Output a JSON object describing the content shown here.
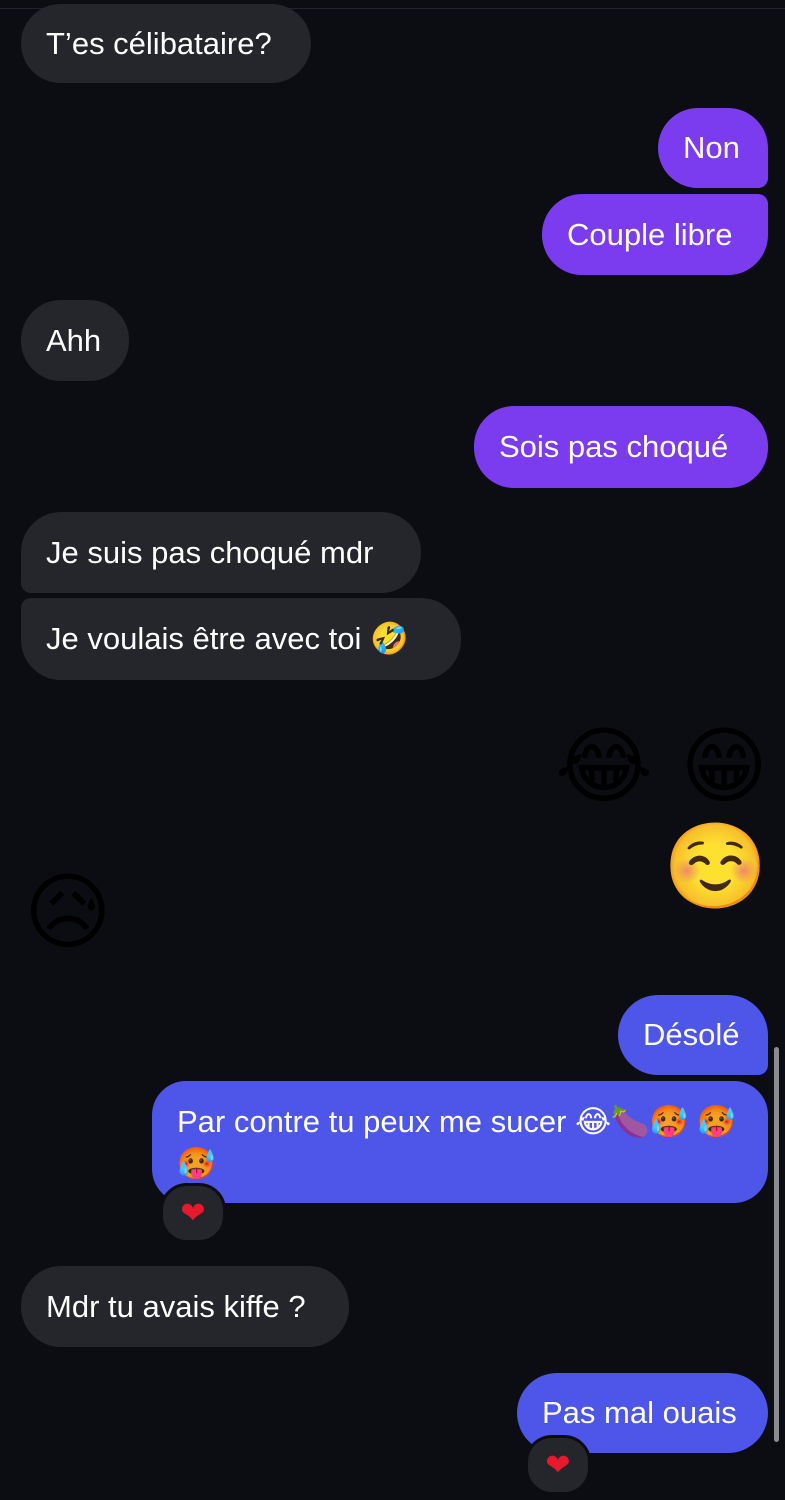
{
  "messages": [
    {
      "id": "m1",
      "text": "T’es célibataire?"
    },
    {
      "id": "m2",
      "text": "Non"
    },
    {
      "id": "m3",
      "text": "Couple libre"
    },
    {
      "id": "m4",
      "text": "Ahh"
    },
    {
      "id": "m5",
      "text": "Sois pas choqué"
    },
    {
      "id": "m6",
      "text": "Je suis pas choqué mdr"
    },
    {
      "id": "m7",
      "text": "Je voulais être avec toi 🤣"
    },
    {
      "id": "m8",
      "text": "😂 😁 ☺️"
    },
    {
      "id": "m9",
      "text": "😥"
    },
    {
      "id": "m10",
      "text": "Désolé"
    },
    {
      "id": "m11",
      "text": "Par contre tu peux me sucer 😂🍆🥵 🥵 🥵"
    },
    {
      "id": "m12",
      "text": "Mdr tu avais kiffe ?"
    },
    {
      "id": "m13",
      "text": "Pas mal ouais"
    }
  ],
  "reactions": {
    "r1": "❤",
    "r2": "❤"
  },
  "colors": {
    "background": "#0c0d12",
    "incoming_bubble": "#25262b",
    "outgoing_purple": "#7b3cf0",
    "outgoing_blue": "#4e55e9",
    "reaction_heart": "#e8192c"
  }
}
